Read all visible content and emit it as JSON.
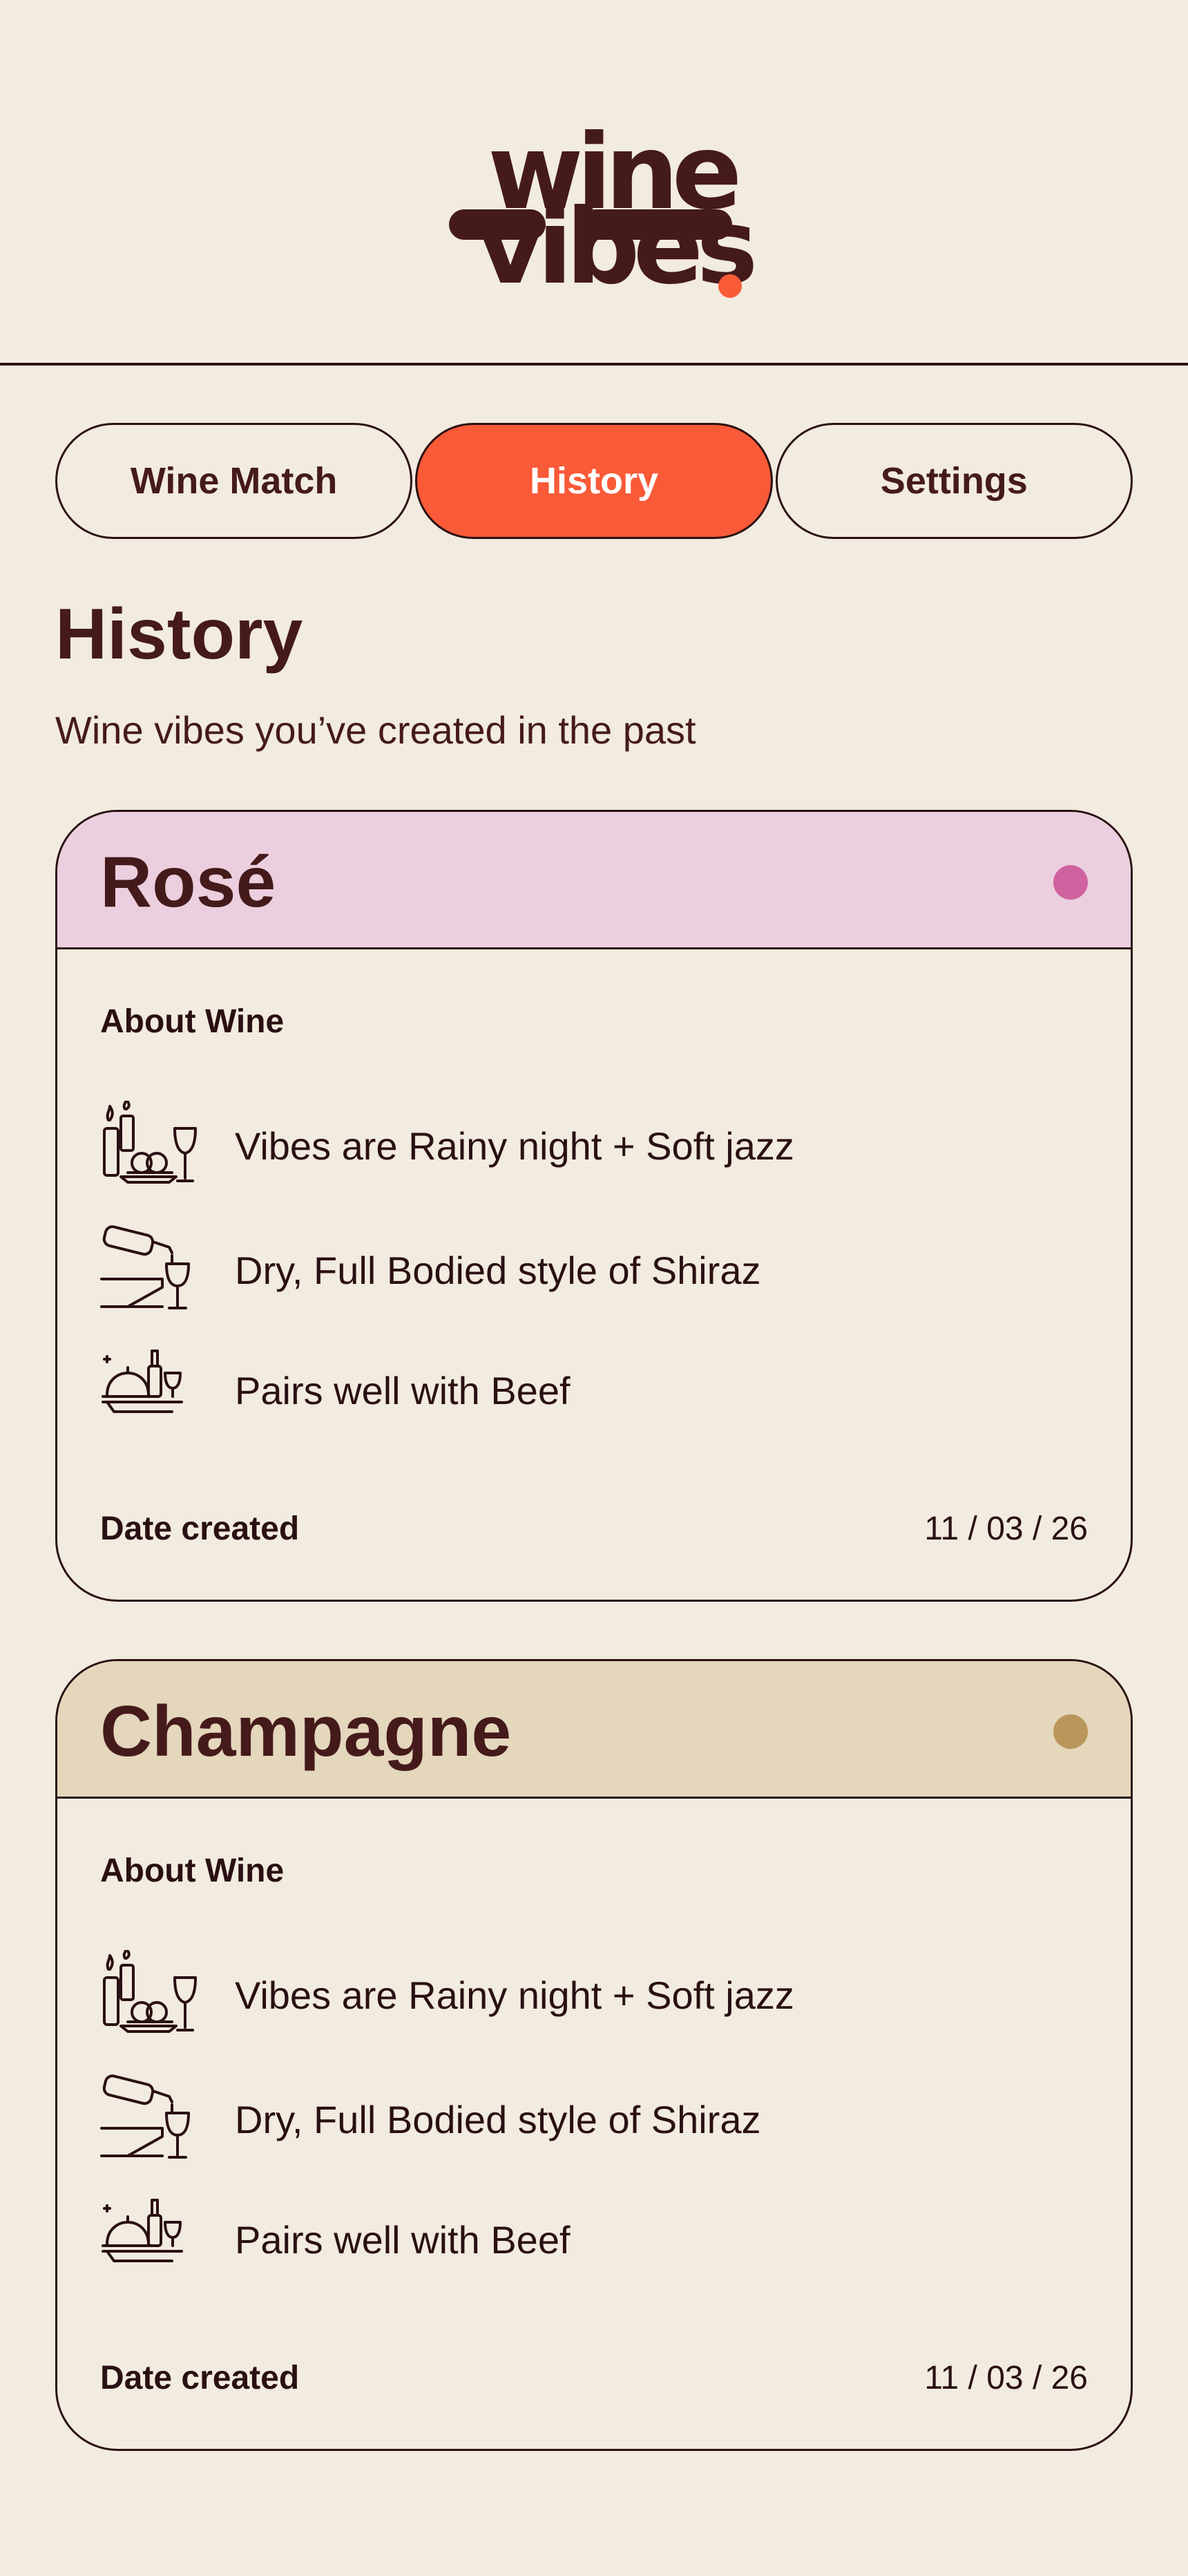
{
  "app": {
    "logo": {
      "line1": "wine",
      "line2": "vibes"
    },
    "accent_color": "#F95A37",
    "text_color": "#451A1B",
    "background_color": "#F2EBDF"
  },
  "tabs": [
    {
      "label": "Wine Match",
      "active": false
    },
    {
      "label": "History",
      "active": true
    },
    {
      "label": "Settings",
      "active": false
    }
  ],
  "page": {
    "title": "History",
    "subtitle": "Wine vibes you’ve created in the past"
  },
  "cards": [
    {
      "title": "Rosé",
      "header_color": "#EBCFDE",
      "dot_color": "#D0629F",
      "about_label": "About Wine",
      "features": [
        {
          "icon": "candles-table-icon",
          "text": "Vibes are Rainy night + Soft jazz"
        },
        {
          "icon": "wine-pour-icon",
          "text": "Dry, Full Bodied style of Shiraz"
        },
        {
          "icon": "food-pairing-icon",
          "text": "Pairs well with Beef"
        }
      ],
      "date_label": "Date created",
      "date_value": "11 / 03 / 26"
    },
    {
      "title": "Champagne",
      "header_color": "#E4D7BC",
      "dot_color": "#B9965C",
      "about_label": "About Wine",
      "features": [
        {
          "icon": "candles-table-icon",
          "text": "Vibes are Rainy night + Soft jazz"
        },
        {
          "icon": "wine-pour-icon",
          "text": "Dry, Full Bodied style of Shiraz"
        },
        {
          "icon": "food-pairing-icon",
          "text": "Pairs well with Beef"
        }
      ],
      "date_label": "Date created",
      "date_value": "11 / 03 / 26"
    }
  ]
}
